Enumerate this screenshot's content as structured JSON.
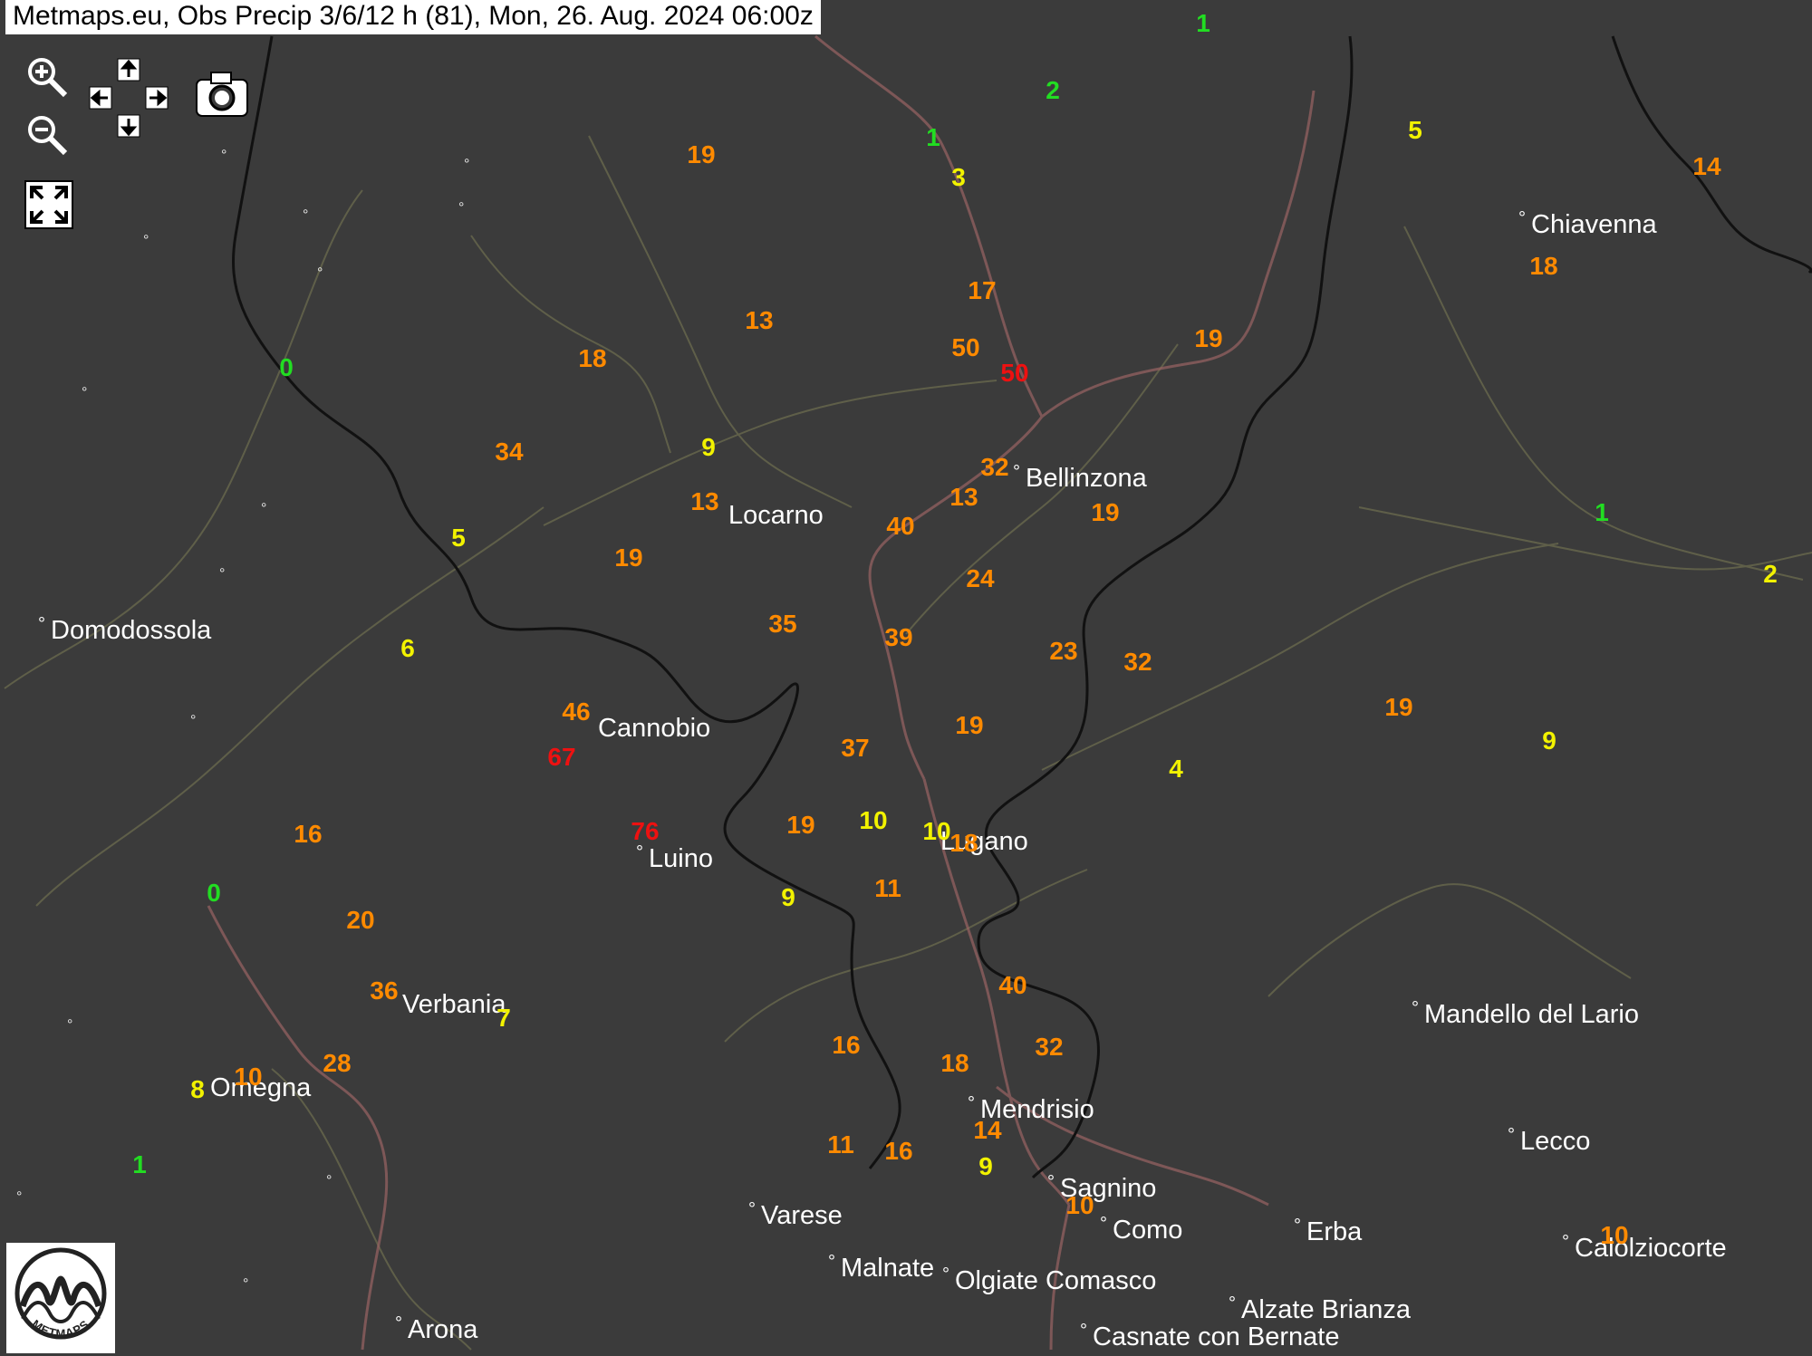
{
  "title": "Metmaps.eu, Obs Precip 3/6/12 h (81), Mon, 26. Aug. 2024 06:00z",
  "colors": {
    "green": "#22dd22",
    "yellow": "#f2f200",
    "orange": "#ff8a00",
    "red": "#ee1111",
    "background": "#3b3b3b",
    "border": "#111111",
    "road": "#9a6464",
    "river": "#8a8a5a"
  },
  "controls": {
    "zoom_in": "zoom-in-icon",
    "zoom_out": "zoom-out-icon",
    "pan": "pan-arrows-icon",
    "screenshot": "camera-icon",
    "fullscreen": "fullscreen-icon"
  },
  "logo_text": "METMAPS",
  "cities": [
    {
      "name": "Chiavenna"
    },
    {
      "name": "Bellinzona"
    },
    {
      "name": "Locarno"
    },
    {
      "name": "Domodossola"
    },
    {
      "name": "Cannobio"
    },
    {
      "name": "Luino"
    },
    {
      "name": "Lugano"
    },
    {
      "name": "Verbania"
    },
    {
      "name": "Omegna"
    },
    {
      "name": "Mandello del Lario"
    },
    {
      "name": "Mendrisio"
    },
    {
      "name": "Lecco"
    },
    {
      "name": "Sagnino"
    },
    {
      "name": "Varese"
    },
    {
      "name": "Como"
    },
    {
      "name": "Erba"
    },
    {
      "name": "Calolziocorte"
    },
    {
      "name": "Malnate"
    },
    {
      "name": "Olgiate Comasco"
    },
    {
      "name": "Alzate Brianza"
    },
    {
      "name": "Arona"
    },
    {
      "name": "Casnate con Bernate"
    }
  ],
  "observations": [
    {
      "value": "1",
      "color": "green"
    },
    {
      "value": "2",
      "color": "green"
    },
    {
      "value": "5",
      "color": "yellow"
    },
    {
      "value": "14",
      "color": "orange"
    },
    {
      "value": "19",
      "color": "orange"
    },
    {
      "value": "1",
      "color": "green"
    },
    {
      "value": "3",
      "color": "yellow"
    },
    {
      "value": "18",
      "color": "orange"
    },
    {
      "value": "13",
      "color": "orange"
    },
    {
      "value": "17",
      "color": "orange"
    },
    {
      "value": "0",
      "color": "green"
    },
    {
      "value": "18",
      "color": "orange"
    },
    {
      "value": "50",
      "color": "orange"
    },
    {
      "value": "50",
      "color": "red"
    },
    {
      "value": "19",
      "color": "orange"
    },
    {
      "value": "34",
      "color": "orange"
    },
    {
      "value": "9",
      "color": "yellow"
    },
    {
      "value": "32",
      "color": "orange"
    },
    {
      "value": "13",
      "color": "orange"
    },
    {
      "value": "13",
      "color": "orange"
    },
    {
      "value": "19",
      "color": "orange"
    },
    {
      "value": "40",
      "color": "orange"
    },
    {
      "value": "1",
      "color": "green"
    },
    {
      "value": "5",
      "color": "yellow"
    },
    {
      "value": "19",
      "color": "orange"
    },
    {
      "value": "24",
      "color": "orange"
    },
    {
      "value": "2",
      "color": "yellow"
    },
    {
      "value": "35",
      "color": "orange"
    },
    {
      "value": "39",
      "color": "orange"
    },
    {
      "value": "6",
      "color": "yellow"
    },
    {
      "value": "23",
      "color": "orange"
    },
    {
      "value": "32",
      "color": "orange"
    },
    {
      "value": "46",
      "color": "orange"
    },
    {
      "value": "19",
      "color": "orange"
    },
    {
      "value": "19",
      "color": "orange"
    },
    {
      "value": "9",
      "color": "yellow"
    },
    {
      "value": "67",
      "color": "red"
    },
    {
      "value": "37",
      "color": "orange"
    },
    {
      "value": "4",
      "color": "yellow"
    },
    {
      "value": "16",
      "color": "orange"
    },
    {
      "value": "76",
      "color": "red"
    },
    {
      "value": "19",
      "color": "orange"
    },
    {
      "value": "10",
      "color": "yellow"
    },
    {
      "value": "10",
      "color": "yellow"
    },
    {
      "value": "18",
      "color": "orange"
    },
    {
      "value": "0",
      "color": "green"
    },
    {
      "value": "9",
      "color": "yellow"
    },
    {
      "value": "11",
      "color": "orange"
    },
    {
      "value": "20",
      "color": "orange"
    },
    {
      "value": "40",
      "color": "orange"
    },
    {
      "value": "36",
      "color": "orange"
    },
    {
      "value": "7",
      "color": "yellow"
    },
    {
      "value": "16",
      "color": "orange"
    },
    {
      "value": "18",
      "color": "orange"
    },
    {
      "value": "32",
      "color": "orange"
    },
    {
      "value": "28",
      "color": "orange"
    },
    {
      "value": "10",
      "color": "orange"
    },
    {
      "value": "8",
      "color": "yellow"
    },
    {
      "value": "14",
      "color": "orange"
    },
    {
      "value": "11",
      "color": "orange"
    },
    {
      "value": "16",
      "color": "orange"
    },
    {
      "value": "1",
      "color": "green"
    },
    {
      "value": "9",
      "color": "yellow"
    },
    {
      "value": "10",
      "color": "orange"
    },
    {
      "value": "10",
      "color": "orange"
    }
  ]
}
